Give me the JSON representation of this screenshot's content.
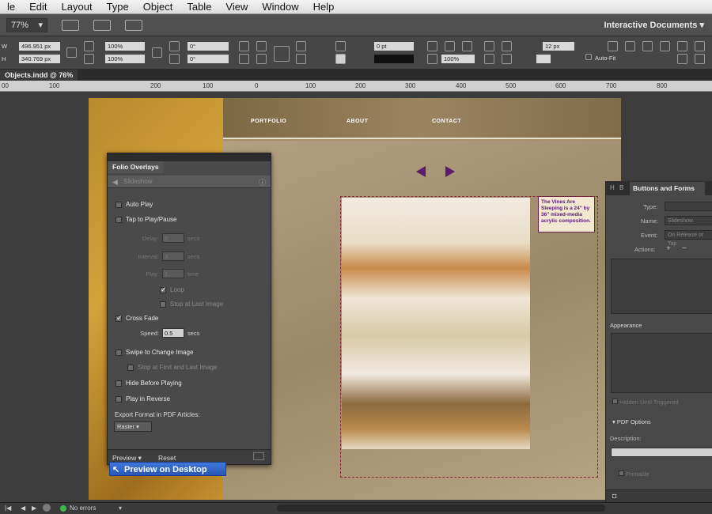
{
  "menubar": {
    "items": [
      "le",
      "Edit",
      "Layout",
      "Type",
      "Object",
      "Table",
      "View",
      "Window",
      "Help"
    ]
  },
  "appbar": {
    "zoom": "77%",
    "workspace": "Interactive Documents"
  },
  "controls": {
    "w_value": "496.951 px",
    "h_value": "340.769 px",
    "w_label": "W",
    "h_label": "H",
    "scale_x": "100%",
    "scale_y": "100%",
    "rotate": "0°",
    "shear": "0°",
    "stroke_weight": "0 pt",
    "opacity": "100%",
    "gap": "12 px",
    "auto_fit": "Auto-Fit"
  },
  "document": {
    "tab_title": "Objects.indd @ 76%"
  },
  "ruler": {
    "ticks": [
      "00",
      "100",
      "200",
      "100",
      "0",
      "100",
      "200",
      "300",
      "400",
      "500",
      "600",
      "700",
      "800"
    ]
  },
  "page": {
    "nav": [
      "PORTFOLIO",
      "ABOUT",
      "CONTACT"
    ],
    "caption": "The Vines Are Sleeping is a 24\" by 36\" mixed-media acrylic composition."
  },
  "folio_panel": {
    "tab": "Folio Overlays",
    "header": "Slideshow",
    "auto_play": "Auto Play",
    "tap_to_play": "Tap to Play/Pause",
    "delay_label": "Delay:",
    "delay_value": "0",
    "delay_unit": "secs",
    "interval_label": "Interval:",
    "interval_value": "3",
    "interval_unit": "secs",
    "play_label": "Play:",
    "play_value": "1",
    "play_unit": "time",
    "loop": "Loop",
    "stop_last": "Stop at Last Image",
    "cross_fade": "Cross Fade",
    "speed_label": "Speed:",
    "speed_value": "0.5",
    "speed_unit": "secs",
    "swipe": "Swipe to Change Image",
    "stop_first_last": "Stop at First and Last Image",
    "hide_before": "Hide Before Playing",
    "play_reverse": "Play in Reverse",
    "export_label": "Export Format in PDF Articles:",
    "export_value": "Raster",
    "preview": "Preview",
    "reset": "Reset",
    "preview_desktop": "Preview on Desktop"
  },
  "buttons_forms_panel": {
    "tab": "Buttons and Forms",
    "type_label": "Type:",
    "name_label": "Name:",
    "name_value": "Slideshow",
    "event_label": "Event:",
    "event_value": "On Release or Tap",
    "actions_label": "Actions:",
    "appearance": "Appearance",
    "hidden_until": "Hidden Until Triggered",
    "pdf_options": "PDF Options",
    "description": "Description:",
    "printable": "Printable"
  },
  "status": {
    "errors": "No errors"
  }
}
